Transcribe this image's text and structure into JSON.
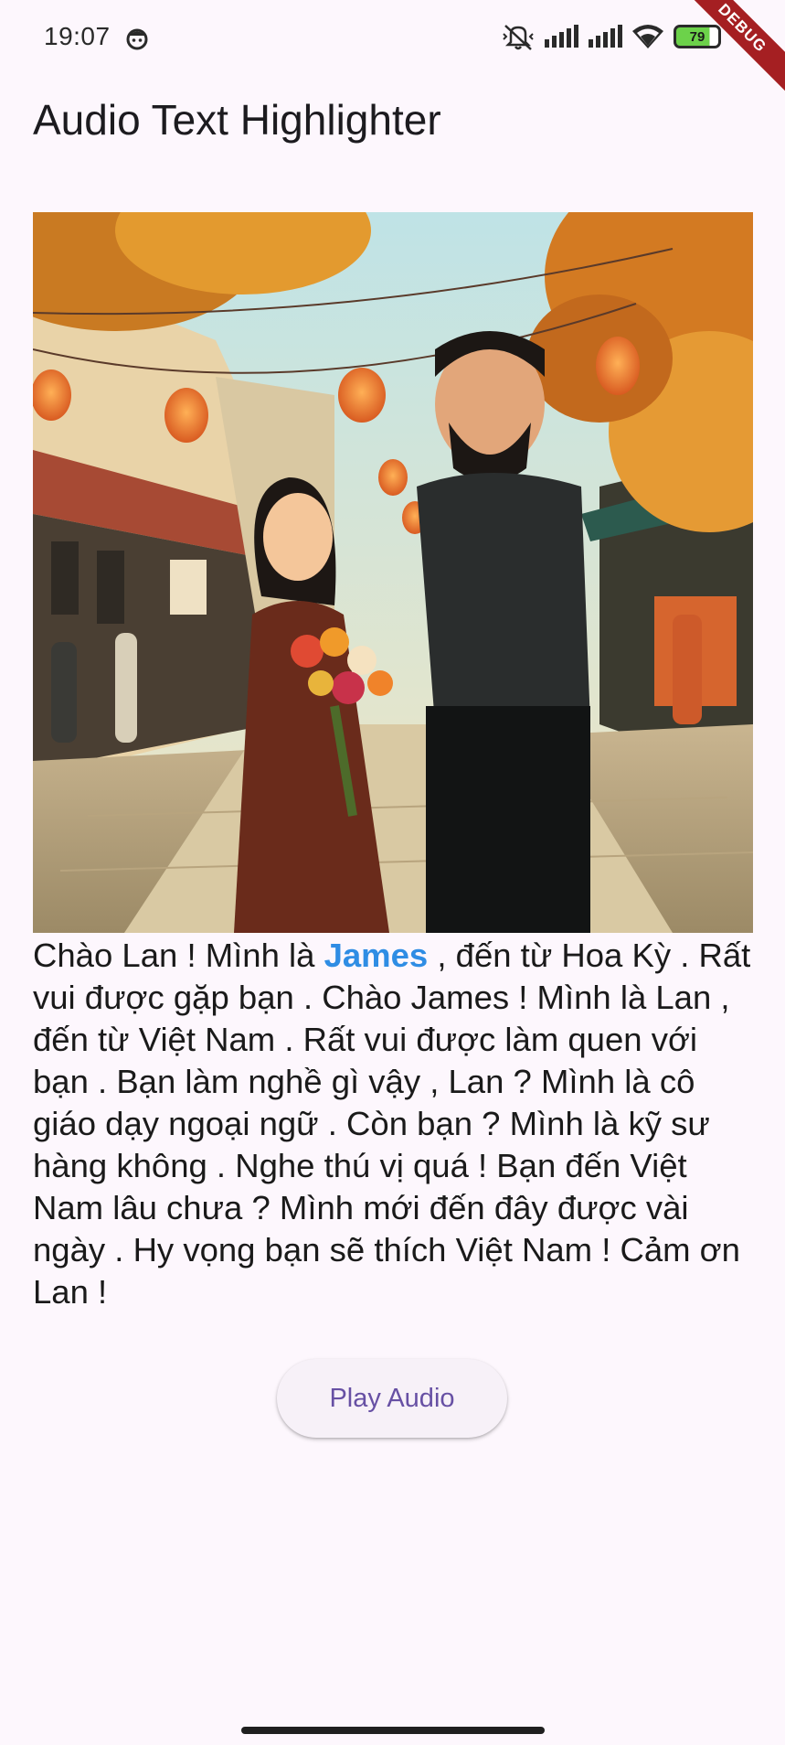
{
  "status_bar": {
    "time": "19:07",
    "battery_level": "79",
    "icons": [
      "face-icon",
      "mute-icon",
      "signal-icon",
      "signal-icon",
      "wifi-icon",
      "battery-icon"
    ]
  },
  "debug_banner": "DEBUG",
  "app_bar": {
    "title": "Audio Text Highlighter"
  },
  "image": {
    "semantic": "illustration of a woman holding a bouquet and a bearded man on an autumn street with lanterns"
  },
  "dialog": {
    "before": "Chào Lan ! Mình là ",
    "highlighted": "James",
    "after": " , đến từ Hoa Kỳ . Rất vui được gặp bạn . Chào James ! Mình là Lan , đến từ Việt Nam . Rất vui được làm quen với bạn . Bạn làm nghề gì vậy , Lan ? Mình là cô giáo dạy ngoại ngữ . Còn bạn ? Mình là kỹ sư hàng không . Nghe thú vị quá ! Bạn đến Việt Nam lâu chưa ? Mình mới đến đây được vài ngày . Hy vọng bạn sẽ thích Việt Nam ! Cảm ơn Lan !",
    "highlight_color": "#2f8de4"
  },
  "play_button": {
    "label": "Play Audio"
  },
  "colors": {
    "background": "#fdf7fd",
    "accent": "#6750a4",
    "debug": "#a51f22"
  }
}
